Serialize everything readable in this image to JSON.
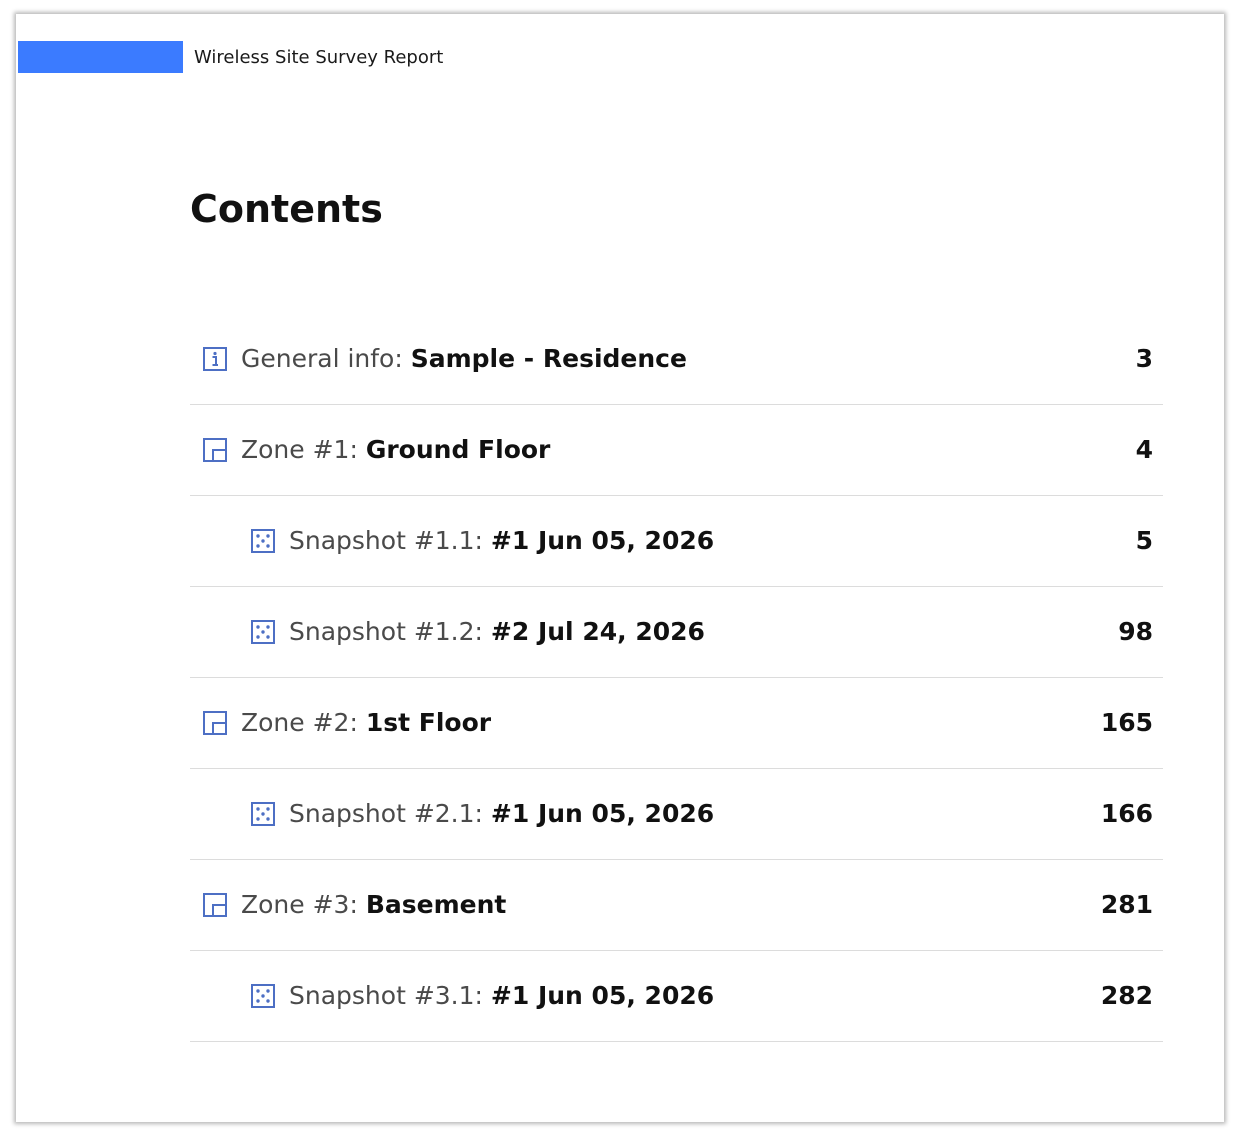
{
  "header": {
    "title": "Wireless Site Survey Report",
    "accent_color": "#3b7bff"
  },
  "contents": {
    "title": "Contents",
    "icon_color": "#4d6fc4",
    "entries": [
      {
        "level": 1,
        "icon": "info-icon",
        "prefix": "General info: ",
        "name": "Sample - Residence",
        "page": "3"
      },
      {
        "level": 1,
        "icon": "zone-icon",
        "prefix": "Zone #1: ",
        "name": "Ground Floor",
        "page": "4"
      },
      {
        "level": 2,
        "icon": "snapshot-icon",
        "prefix": "Snapshot #1.1: ",
        "name": "#1 Jun 05, 2026",
        "page": "5"
      },
      {
        "level": 2,
        "icon": "snapshot-icon",
        "prefix": "Snapshot #1.2: ",
        "name": "#2 Jul 24, 2026",
        "page": "98"
      },
      {
        "level": 1,
        "icon": "zone-icon",
        "prefix": "Zone #2: ",
        "name": "1st Floor",
        "page": "165"
      },
      {
        "level": 2,
        "icon": "snapshot-icon",
        "prefix": "Snapshot #2.1: ",
        "name": "#1 Jun 05, 2026",
        "page": "166"
      },
      {
        "level": 1,
        "icon": "zone-icon",
        "prefix": "Zone #3: ",
        "name": "Basement",
        "page": "281"
      },
      {
        "level": 2,
        "icon": "snapshot-icon",
        "prefix": "Snapshot #3.1: ",
        "name": "#1 Jun 05, 2026",
        "page": "282"
      }
    ]
  }
}
